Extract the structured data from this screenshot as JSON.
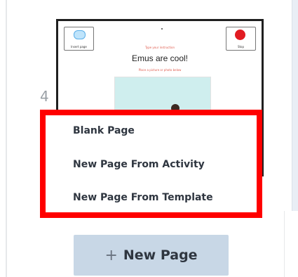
{
  "page_number": "4",
  "thumbnail": {
    "left_tool_label": "Insert page",
    "right_tool_label": "Stop",
    "hint_top": "Type your instruction",
    "title": "Emus are cool!",
    "hint_bottom": "Place a picture or photo below"
  },
  "menu": {
    "items": [
      {
        "label": "Blank Page"
      },
      {
        "label": "New Page From Activity"
      },
      {
        "label": "New Page From Template"
      }
    ]
  },
  "new_page_button": {
    "icon": "plus-icon",
    "label": "New Page"
  },
  "colors": {
    "highlight": "#ff0000",
    "button_bg": "#c8d7e6",
    "text": "#2f3640"
  }
}
